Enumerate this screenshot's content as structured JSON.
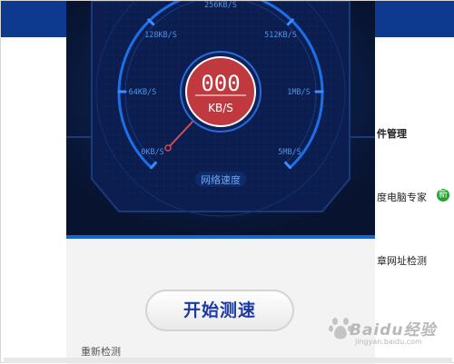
{
  "background": {
    "right_menu": [
      "件管理",
      "度电脑专家",
      "章网址检测"
    ]
  },
  "panel": {
    "gauge": {
      "speed_value": "000",
      "speed_unit": "KB/S",
      "label": "网络速度",
      "ticks": [
        "0KB/S",
        "64KB/S",
        "128KB/S",
        "256KB/S",
        "512KB/S",
        "1MB/S",
        "5MB/S"
      ]
    },
    "start_button": "开始测速",
    "recheck_label": "重新检测"
  },
  "watermark": {
    "main": "Baidu经验",
    "sub": "jingyan.baidu.com"
  },
  "colors": {
    "accent": "#1e6ee8",
    "dial_red": "#c0393f",
    "panel_bg": "#0a1b45",
    "button_text": "#1a3aa3"
  }
}
